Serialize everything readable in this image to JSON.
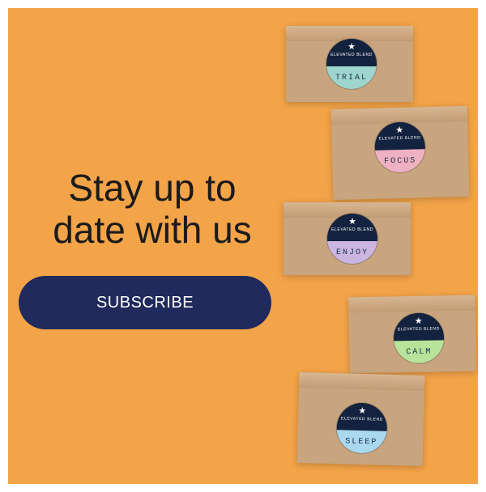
{
  "promo": {
    "headline_line_1": "Stay up to",
    "headline_line_2": "date with us",
    "subscribe_label": "SUBSCRIBE"
  },
  "colors": {
    "background": "#f3a348",
    "button": "#202a5c",
    "label_dark": "#13223e",
    "trial": "#9ed6cf",
    "focus": "#efb1c2",
    "enjoy": "#cab6e1",
    "calm": "#b8e39a",
    "sleep": "#a9d8ef"
  },
  "boxes": [
    {
      "label": "TRIAL",
      "brand_text": "ELEVATED BLEND",
      "icon": "star-icon"
    },
    {
      "label": "FOCUS",
      "brand_text": "ELEVATED BLEND",
      "icon": "star-icon"
    },
    {
      "label": "ENJOY",
      "brand_text": "ELEVATED BLEND",
      "icon": "star-icon"
    },
    {
      "label": "CALM",
      "brand_text": "ELEVATED BLEND",
      "icon": "star-icon"
    },
    {
      "label": "SLEEP",
      "brand_text": "ELEVATED BLEND",
      "icon": "star-icon"
    }
  ]
}
